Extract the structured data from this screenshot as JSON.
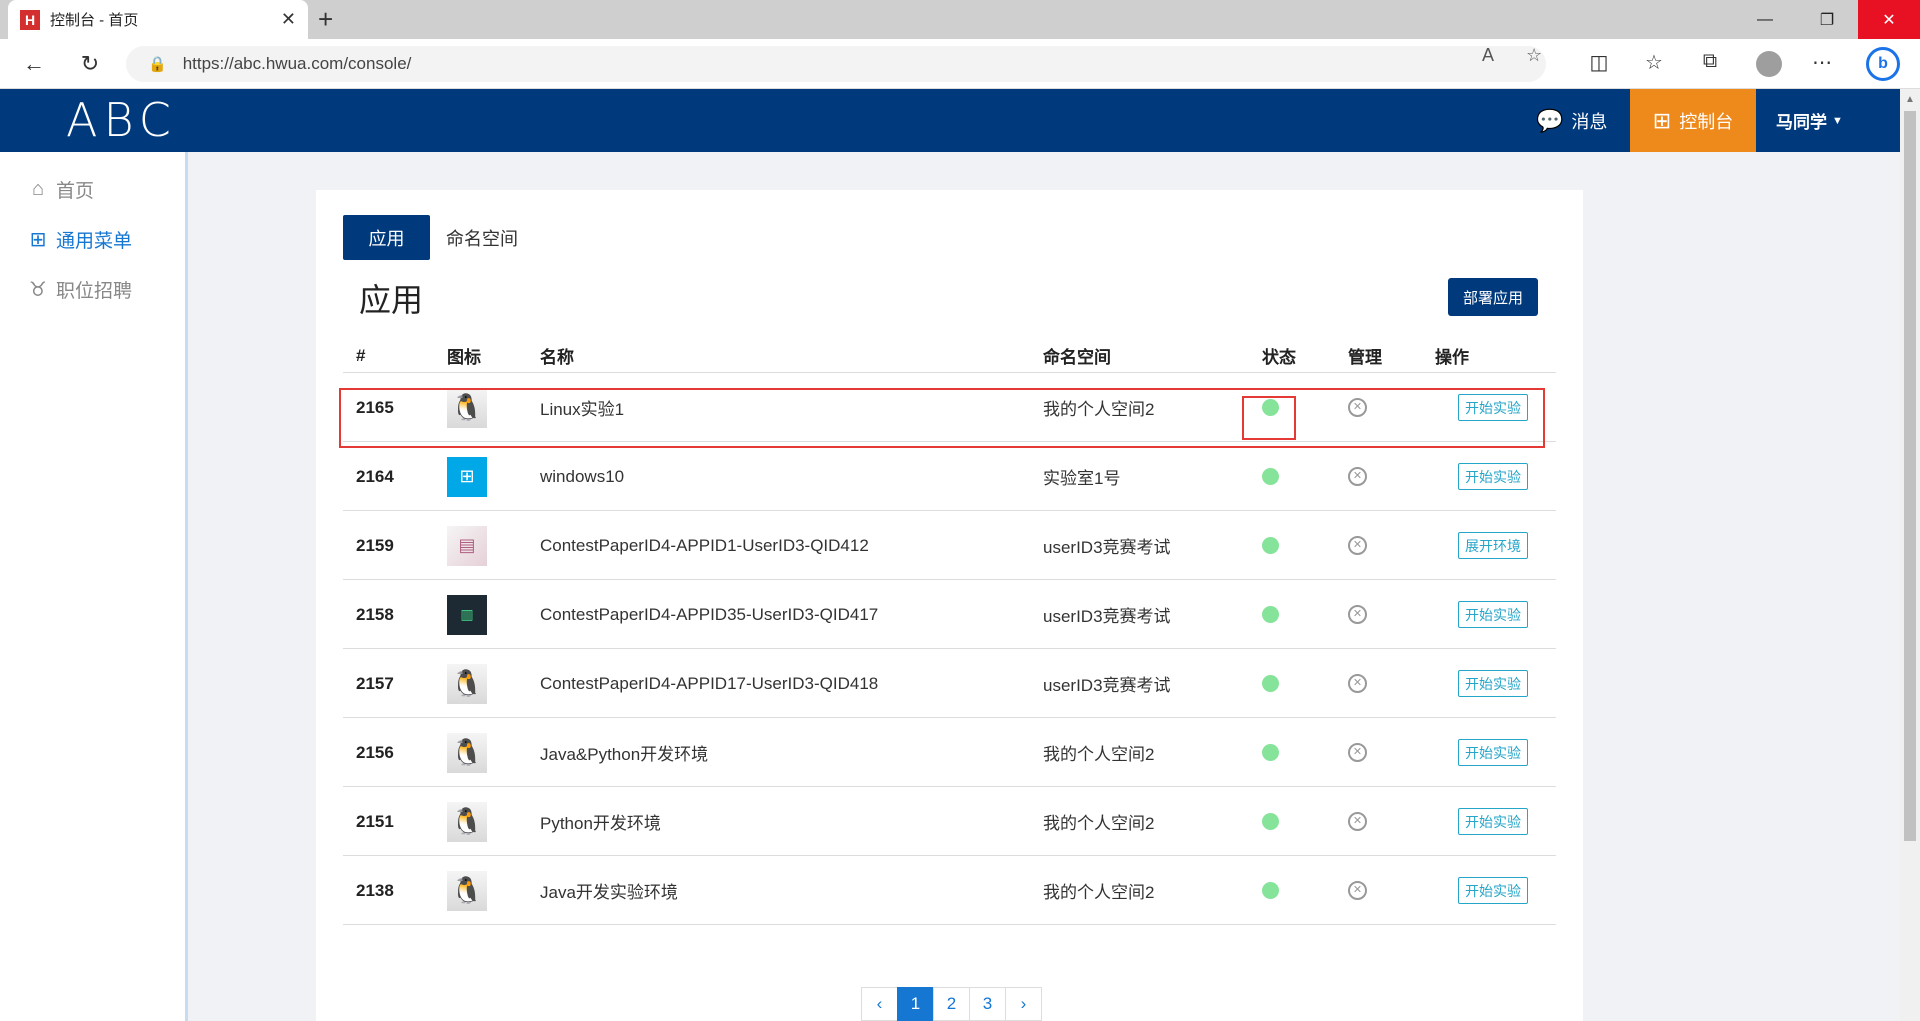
{
  "browser": {
    "tab_title": "控制台 - 首页",
    "tab_favicon": "H",
    "url": "https://abc.hwua.com/console/"
  },
  "header": {
    "logo": "ABC",
    "messages_label": "消息",
    "console_label": "控制台",
    "user_name": "马同学"
  },
  "sidebar": {
    "items": [
      {
        "label": "首页",
        "icon": "home-icon"
      },
      {
        "label": "通用菜单",
        "icon": "grid-icon"
      },
      {
        "label": "职位招聘",
        "icon": "tie-icon"
      }
    ]
  },
  "main": {
    "tabs": [
      "应用",
      "命名空间"
    ],
    "title": "应用",
    "deploy_button": "部署应用",
    "columns": [
      "#",
      "图标",
      "名称",
      "命名空间",
      "状态",
      "管理",
      "操作"
    ],
    "rows": [
      {
        "id": "2165",
        "icon": "linux",
        "name": "Linux实验1",
        "namespace": "我的个人空间2",
        "action": "开始实验"
      },
      {
        "id": "2164",
        "icon": "windows",
        "name": "windows10",
        "namespace": "实验室1号",
        "action": "开始实验"
      },
      {
        "id": "2159",
        "icon": "paper",
        "name": "ContestPaperID4-APPID1-UserID3-QID412",
        "namespace": "userID3竞赛考试",
        "action": "展开环境"
      },
      {
        "id": "2158",
        "icon": "dark",
        "name": "ContestPaperID4-APPID35-UserID3-QID417",
        "namespace": "userID3竞赛考试",
        "action": "开始实验"
      },
      {
        "id": "2157",
        "icon": "linux",
        "name": "ContestPaperID4-APPID17-UserID3-QID418",
        "namespace": "userID3竞赛考试",
        "action": "开始实验"
      },
      {
        "id": "2156",
        "icon": "linux",
        "name": "Java&Python开发环境",
        "namespace": "我的个人空间2",
        "action": "开始实验"
      },
      {
        "id": "2151",
        "icon": "linux",
        "name": "Python开发环境",
        "namespace": "我的个人空间2",
        "action": "开始实验"
      },
      {
        "id": "2138",
        "icon": "linux",
        "name": "Java开发实验环境",
        "namespace": "我的个人空间2",
        "action": "开始实验"
      }
    ],
    "pagination": {
      "prev": "‹",
      "pages": [
        "1",
        "2",
        "3"
      ],
      "next": "›",
      "current": "1"
    }
  },
  "colors": {
    "brand": "#003a7d",
    "accent_orange": "#ee8a1c",
    "status_running": "#86e39a",
    "highlight": "#e53935"
  }
}
